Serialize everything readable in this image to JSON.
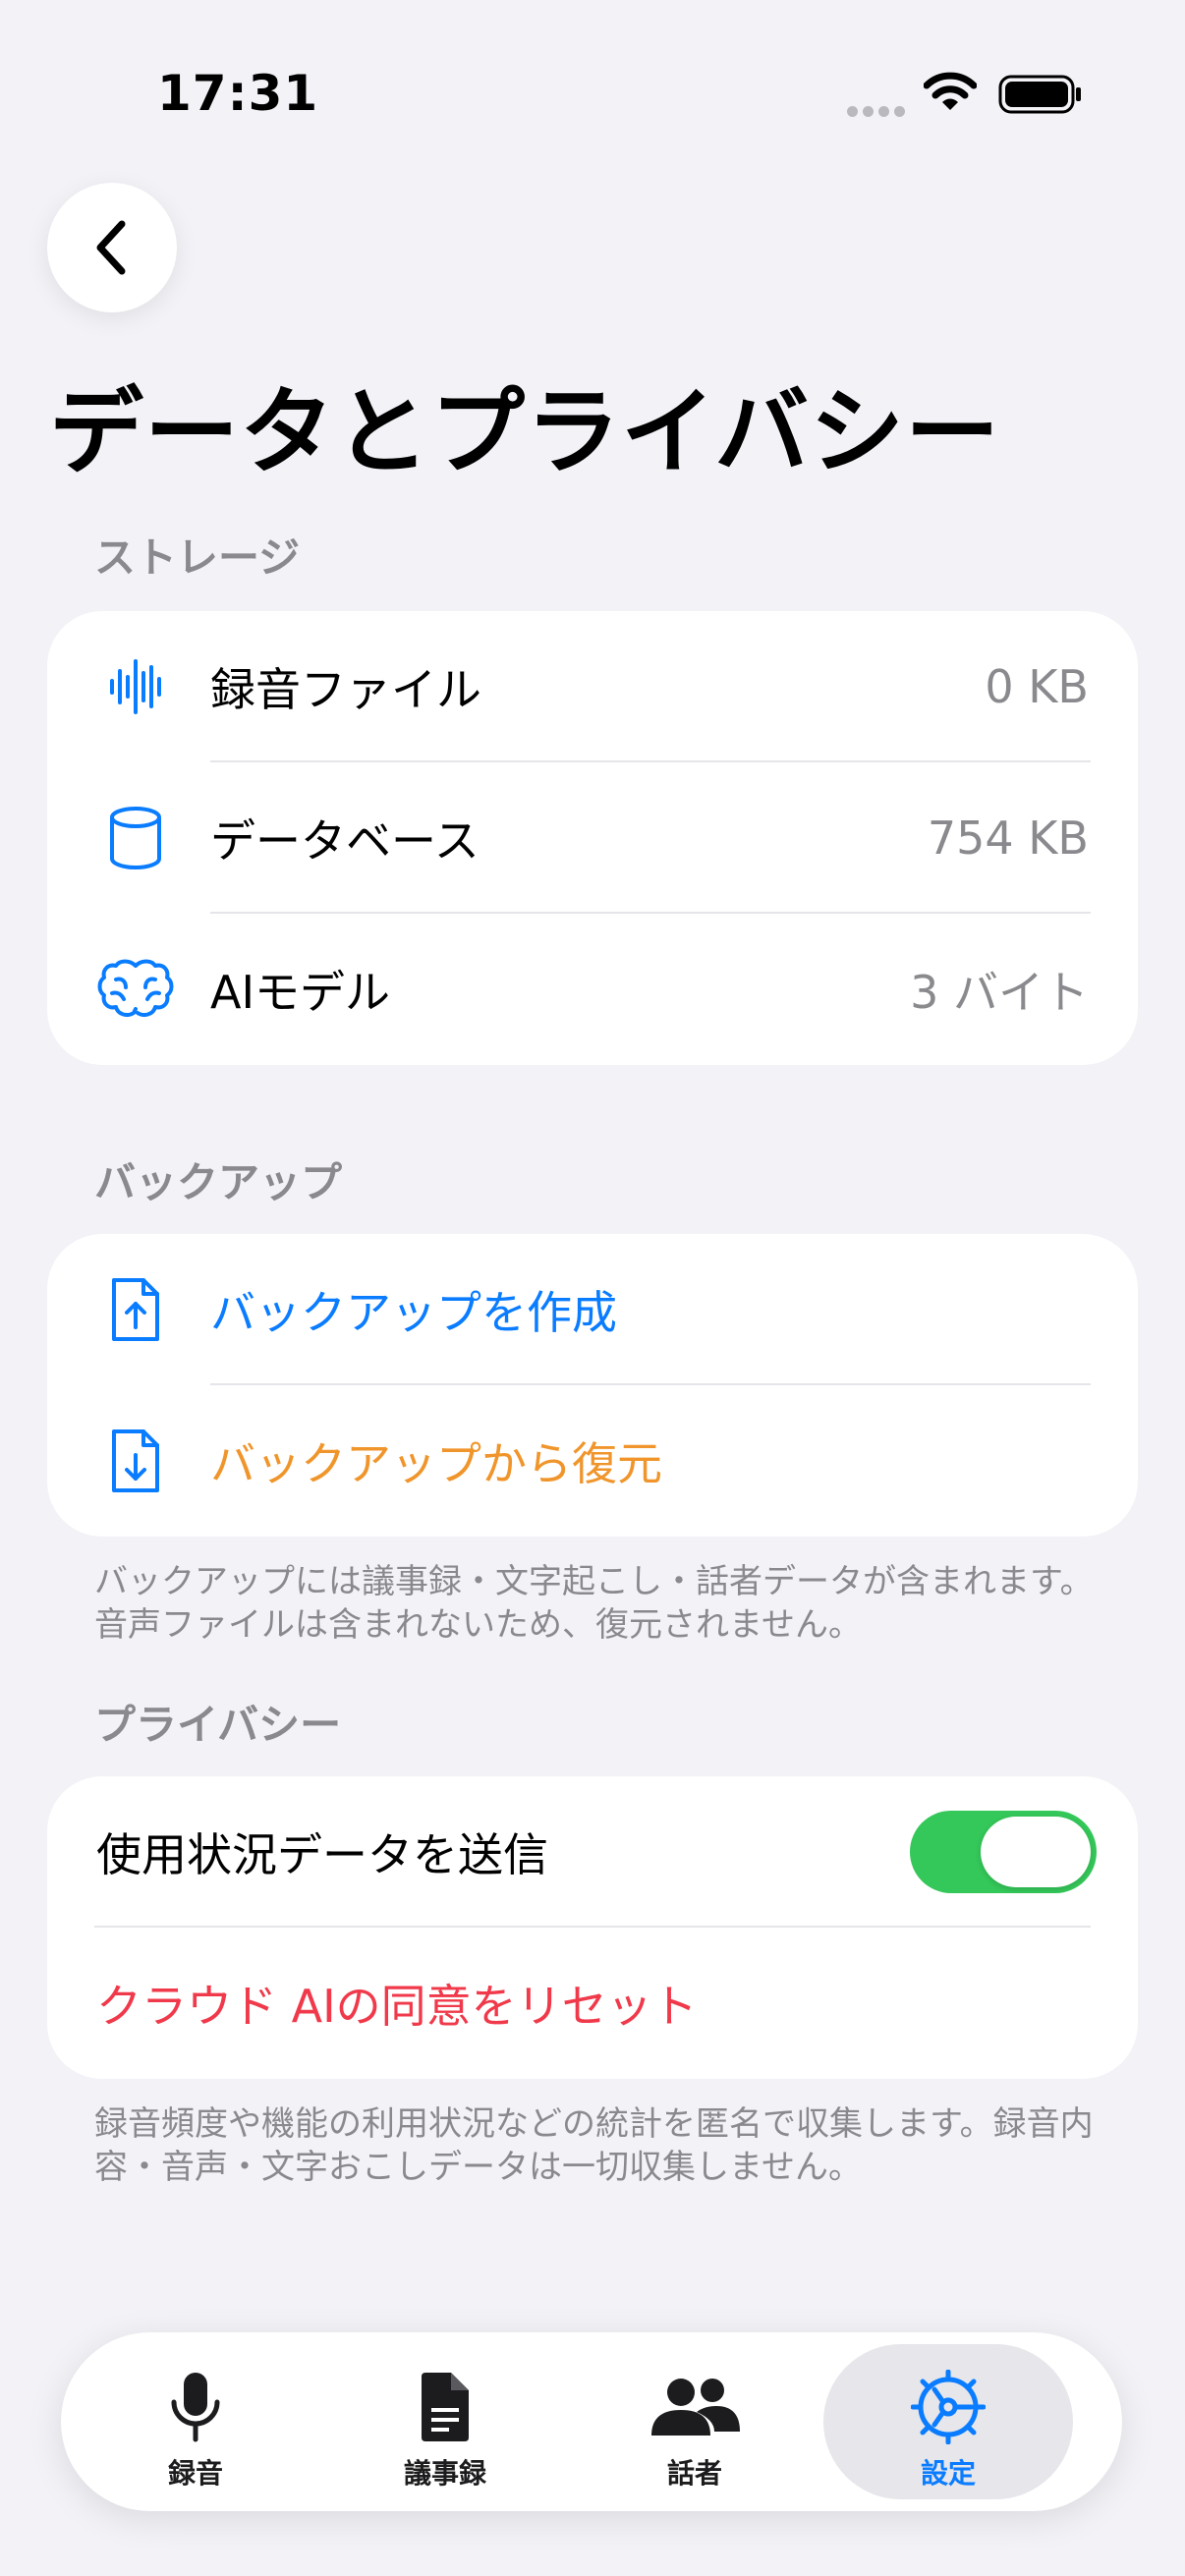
{
  "status_bar": {
    "time": "17:31"
  },
  "header": {
    "title": "データとプライバシー"
  },
  "storage": {
    "header": "ストレージ",
    "items": [
      {
        "label": "録音ファイル",
        "value": "0 KB",
        "icon": "waveform-icon"
      },
      {
        "label": "データベース",
        "value": "754 KB",
        "icon": "cylinder-icon"
      },
      {
        "label": "AIモデル",
        "value": "3 バイト",
        "icon": "brain-icon"
      }
    ]
  },
  "backup": {
    "header": "バックアップ",
    "create_label": "バックアップを作成",
    "restore_label": "バックアップから復元",
    "footnote": "バックアップには議事録・文字起こし・話者データが含まれます。音声ファイルは含まれないため、復元されません。"
  },
  "privacy": {
    "header": "プライバシー",
    "usage_label": "使用状況データを送信",
    "usage_enabled": true,
    "reset_label": "クラウド AIの同意をリセット",
    "footnote": "録音頻度や機能の利用状況などの統計を匿名で収集します。録音内容・音声・文字おこしデータは一切収集しません。"
  },
  "tabs": [
    {
      "label": "録音",
      "icon": "mic-icon"
    },
    {
      "label": "議事録",
      "icon": "document-icon"
    },
    {
      "label": "話者",
      "icon": "people-icon"
    },
    {
      "label": "設定",
      "icon": "gear-icon",
      "active": true
    }
  ],
  "colors": {
    "accent_blue": "#0a7cff",
    "accent_orange": "#f0952b",
    "destructive_red": "#f0394a",
    "toggle_green": "#34c759",
    "secondary_text": "#8a8a8e",
    "background": "#f2f2f7"
  }
}
